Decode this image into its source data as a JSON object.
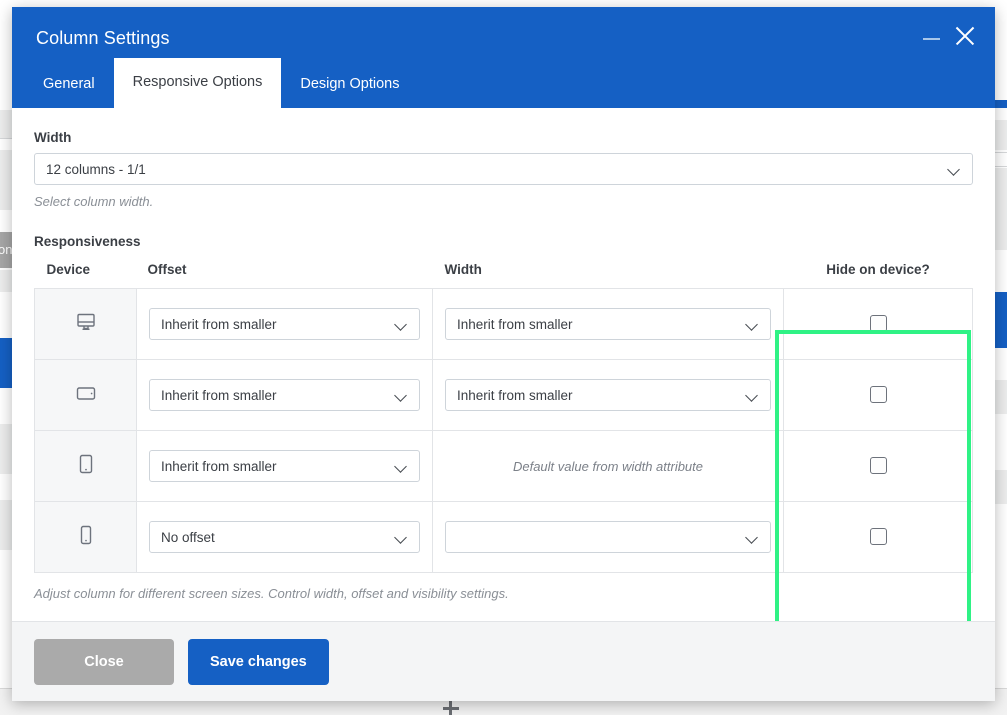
{
  "modal": {
    "title": "Column Settings",
    "window_controls": {
      "minimize": "minimize-icon",
      "close": "close-icon"
    },
    "tabs": [
      {
        "label": "General",
        "active": false
      },
      {
        "label": "Responsive Options",
        "active": true
      },
      {
        "label": "Design Options",
        "active": false
      }
    ],
    "width_section": {
      "label": "Width",
      "value": "12 columns - 1/1",
      "help": "Select column width."
    },
    "responsiveness": {
      "label": "Responsiveness",
      "columns": [
        "Device",
        "Offset",
        "Width",
        "Hide on device?"
      ],
      "rows": [
        {
          "device_icon": "desktop-icon",
          "offset": "Inherit from smaller",
          "width": "Inherit from smaller",
          "width_is_note": false,
          "hide_checked": false
        },
        {
          "device_icon": "tablet-landscape-icon",
          "offset": "Inherit from smaller",
          "width": "Inherit from smaller",
          "width_is_note": false,
          "hide_checked": false
        },
        {
          "device_icon": "tablet-portrait-icon",
          "offset": "Inherit from smaller",
          "width": "Default value from width attribute",
          "width_is_note": true,
          "hide_checked": false
        },
        {
          "device_icon": "mobile-icon",
          "offset": "No offset",
          "width": "",
          "width_is_note": false,
          "hide_checked": false
        }
      ],
      "footnote": "Adjust column for different screen sizes. Control width, offset and visibility settings."
    },
    "footer": {
      "close_label": "Close",
      "save_label": "Save changes"
    }
  },
  "highlight": {
    "color": "#2ff285",
    "target": "hide-on-device-column"
  },
  "background": {
    "left_sidebar_label": "on"
  }
}
